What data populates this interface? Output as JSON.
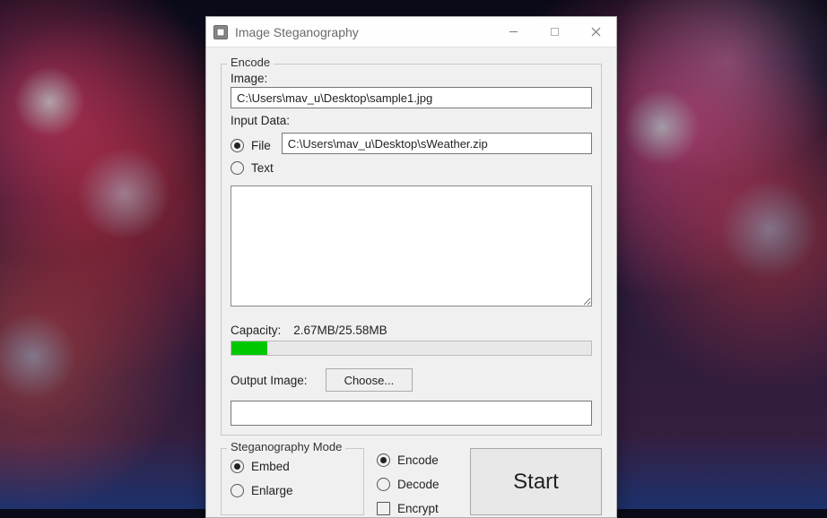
{
  "window": {
    "title": "Image Steganography"
  },
  "encode": {
    "section_label": "Encode",
    "image_label": "Image:",
    "image_path": "C:\\Users\\mav_u\\Desktop\\sample1.jpg",
    "input_data_label": "Input Data:",
    "radio_file_label": "File",
    "radio_text_label": "Text",
    "file_path": "C:\\Users\\mav_u\\Desktop\\sWeather.zip",
    "text_value": "",
    "capacity_label": "Capacity:",
    "capacity_value": "2.67MB/25.58MB",
    "capacity_percent": 10,
    "output_label": "Output Image:",
    "choose_button": "Choose...",
    "output_path": ""
  },
  "mode": {
    "section_label": "Steganography Mode",
    "embed_label": "Embed",
    "enlarge_label": "Enlarge"
  },
  "action": {
    "encode_label": "Encode",
    "decode_label": "Decode",
    "encrypt_label": "Encrypt",
    "start_button": "Start"
  }
}
